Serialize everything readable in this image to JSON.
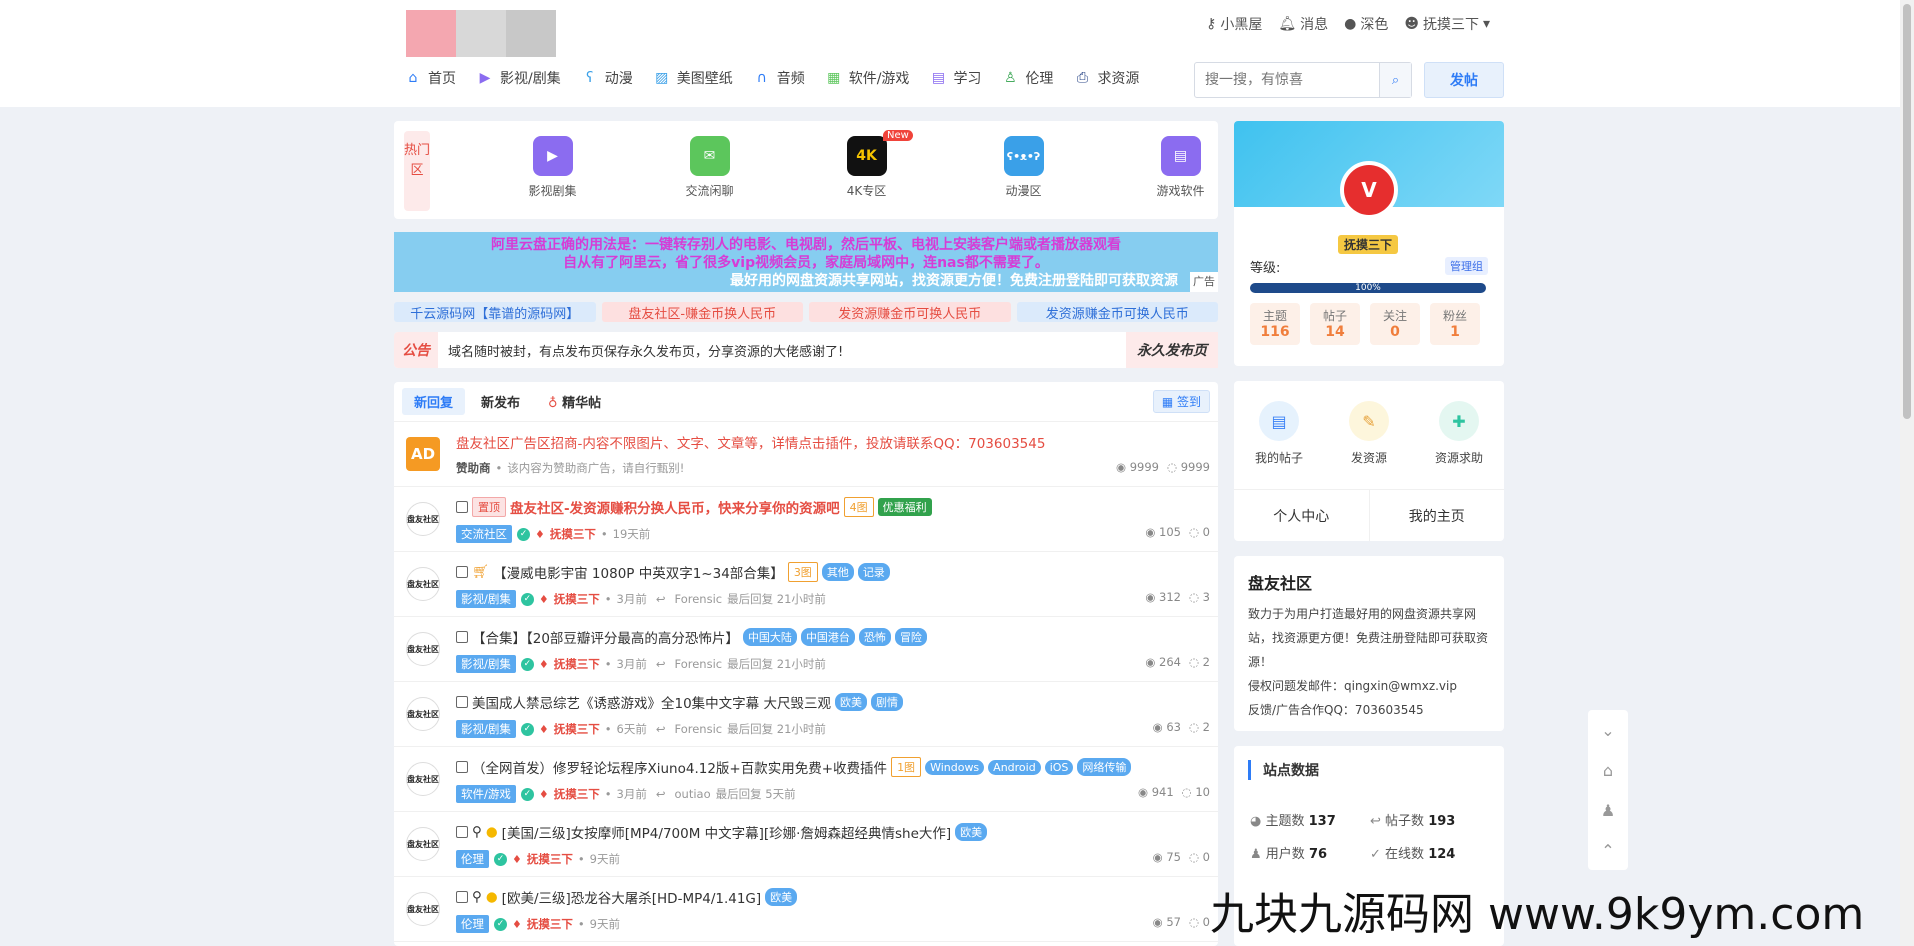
{
  "header": {
    "topbar": {
      "user_tool": "小黑屋",
      "messages": "消息",
      "theme": "深色",
      "username": "抚摸三下"
    },
    "nav": [
      {
        "label": "首页",
        "icon": "home-icon"
      },
      {
        "label": "影视/剧集",
        "icon": "video-icon"
      },
      {
        "label": "动漫",
        "icon": "bear-icon"
      },
      {
        "label": "美图壁纸",
        "icon": "image-icon"
      },
      {
        "label": "音频",
        "icon": "headphones-icon"
      },
      {
        "label": "软件/游戏",
        "icon": "grid-icon"
      },
      {
        "label": "学习",
        "icon": "book-icon"
      },
      {
        "label": "伦理",
        "icon": "person-icon"
      },
      {
        "label": "求资源",
        "icon": "printer-icon"
      }
    ],
    "search_placeholder": "搜一搜，有惊喜",
    "post_button": "发帖"
  },
  "hot": {
    "tag": "热门区",
    "items": [
      {
        "label": "影视剧集",
        "icon": "video-icon",
        "color": "#8b6cf0"
      },
      {
        "label": "交流闲聊",
        "icon": "chat-icon",
        "color": "#5cc65c"
      },
      {
        "label": "4K专区",
        "icon": "4k-icon",
        "color": "#f5c400",
        "text": "4K",
        "new": "New"
      },
      {
        "label": "动漫区",
        "icon": "bear-icon",
        "color": "#3aa0e8"
      },
      {
        "label": "游戏软件",
        "icon": "book-icon",
        "color": "#8b6cf0"
      }
    ]
  },
  "ad_banner": {
    "line1": "阿里云盘正确的用法是：一键转存别人的电影、电视剧，然后平板、电视上安装客户端或者播放器观看",
    "line2": "自从有了阿里云，省了很多vip视频会员，家庭局域网中，连nas都不需要了。",
    "line3": "最好用的网盘资源共享网站，找资源更方便！免费注册登陆即可获取资源",
    "tag": "广告"
  },
  "links": [
    {
      "label": "千云源码网【靠谱的源码网】",
      "bg": "#dbeafb",
      "color": "#2e6fd8"
    },
    {
      "label": "盘友社区-赚金币换人民币",
      "bg": "#fde0e0",
      "color": "#e54d42"
    },
    {
      "label": "发资源赚金币可换人民币",
      "bg": "#fde0e0",
      "color": "#e54d42"
    },
    {
      "label": "发资源赚金币可换人民币",
      "bg": "#dbeafb",
      "color": "#2e6fd8"
    }
  ],
  "notice": {
    "tag": "公告",
    "text": "域名随时被封，有点发布页保存永久发布页，分享资源的大佬感谢了!",
    "permanent": "永久发布页"
  },
  "threads": {
    "tabs": [
      "新回复",
      "新发布",
      "精华帖"
    ],
    "sign": "签到",
    "ad_row": {
      "avatar": "AD",
      "title": "盘友社区广告区招商-内容不限图片、文字、文章等，详情点击插件，投放请联系QQ：703603545",
      "sponsor": "赞助商",
      "note": "该内容为赞助商广告，请自行甄别!",
      "views": "9999",
      "replies": "9999"
    },
    "rows": [
      {
        "prefix": "置顶",
        "title": "盘友社区-发资源赚积分换人民币，快来分享你的资源吧",
        "tags": [
          "4图"
        ],
        "tags2": [
          "优惠福利"
        ],
        "forum": "交流社区",
        "user": "抚摸三下",
        "time": "19天前",
        "last": "",
        "last_time": "",
        "views": "105",
        "replies": "0"
      },
      {
        "prefix": "",
        "title": "【漫威电影宇宙 1080P 中英双字1~34部合集】",
        "tags": [
          "3图"
        ],
        "tags2": [
          "其他",
          "记录"
        ],
        "forum": "影视/剧集",
        "user": "抚摸三下",
        "time": "3月前",
        "last": "Forensic",
        "last_time": "最后回复 21小时前",
        "views": "312",
        "replies": "3"
      },
      {
        "prefix": "",
        "title": "【合集】【20部豆瓣评分最高的高分恐怖片】",
        "tags": [],
        "tags2": [
          "中国大陆",
          "中国港台",
          "恐怖",
          "冒险"
        ],
        "forum": "影视/剧集",
        "user": "抚摸三下",
        "time": "3月前",
        "last": "Forensic",
        "last_time": "最后回复 21小时前",
        "views": "264",
        "replies": "2"
      },
      {
        "prefix": "",
        "title": "美国成人禁忌综艺《诱惑游戏》全10集中文字幕 大尺毁三观",
        "tags": [],
        "tags2": [
          "欧美",
          "剧情"
        ],
        "forum": "影视/剧集",
        "user": "抚摸三下",
        "time": "6天前",
        "last": "Forensic",
        "last_time": "最后回复 21小时前",
        "views": "63",
        "replies": "2"
      },
      {
        "prefix": "",
        "title": "（全网首发）修罗轻论坛程序Xiuno4.12版+百款实用免费+收费插件",
        "tags": [
          "1图"
        ],
        "tags2": [
          "Windows",
          "Android",
          "iOS",
          "网络传输"
        ],
        "forum": "软件/游戏",
        "user": "抚摸三下",
        "time": "3月前",
        "last": "outiao",
        "last_time": "最后回复 5天前",
        "views": "941",
        "replies": "10"
      },
      {
        "prefix": "",
        "title": "[美国/三级]女按摩师[MP4/700M 中文字幕][珍娜·詹姆森超经典情she大作]",
        "tags": [],
        "tags2": [
          "欧美"
        ],
        "forum": "伦理",
        "user": "抚摸三下",
        "time": "9天前",
        "last": "",
        "last_time": "",
        "views": "75",
        "replies": "0"
      },
      {
        "prefix": "",
        "title": "[欧美/三级]恐龙谷大屠杀[HD-MP4/1.41G]",
        "tags": [],
        "tags2": [
          "欧美"
        ],
        "forum": "伦理",
        "user": "抚摸三下",
        "time": "9天前",
        "last": "",
        "last_time": "",
        "views": "57",
        "replies": "0"
      }
    ]
  },
  "profile": {
    "name": "抚摸三下",
    "level_label": "等级:",
    "group": "管理组",
    "progress": "100%",
    "stats": [
      {
        "label": "主题",
        "value": "116"
      },
      {
        "label": "帖子",
        "value": "14"
      },
      {
        "label": "关注",
        "value": "0"
      },
      {
        "label": "粉丝",
        "value": "1"
      }
    ]
  },
  "actions": {
    "items": [
      {
        "label": "我的帖子",
        "icon": "document-icon",
        "bg": "#e6f2fd",
        "color": "#3b82f6"
      },
      {
        "label": "发资源",
        "icon": "edit-icon",
        "bg": "#fdf6dc",
        "color": "#e6a23c"
      },
      {
        "label": "资源求助",
        "icon": "help-icon",
        "bg": "#e4f7f1",
        "color": "#2ec4a0"
      }
    ],
    "personal_center": "个人中心",
    "my_home": "我的主页"
  },
  "about": {
    "title": "盘友社区",
    "desc": "致力于为用户打造最好用的网盘资源共享网站，找资源更方便！免费注册登陆即可获取资源！",
    "email": "侵权问题发邮件：qingxin@wmxz.vip",
    "qq": "反馈/广告合作QQ：703603545"
  },
  "site_stats": {
    "title": "站点数据",
    "items": [
      {
        "label": "主题数",
        "value": "137"
      },
      {
        "label": "帖子数",
        "value": "193"
      },
      {
        "label": "用户数",
        "value": "76"
      },
      {
        "label": "在线数",
        "value": "124"
      }
    ]
  },
  "watermark": "九块九源码网 www.9k9ym.com"
}
